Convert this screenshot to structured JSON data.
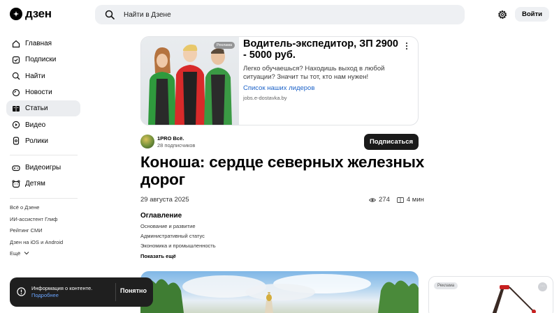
{
  "header": {
    "logo_text": "дзен",
    "search_placeholder": "Найти в Дзене",
    "login_label": "Войти"
  },
  "sidebar": {
    "main_items": [
      {
        "label": "Главная",
        "icon": "home-icon"
      },
      {
        "label": "Подписки",
        "icon": "subscriptions-icon"
      },
      {
        "label": "Найти",
        "icon": "search-icon"
      },
      {
        "label": "Новости",
        "icon": "news-icon"
      },
      {
        "label": "Статьи",
        "icon": "articles-icon",
        "active": true
      },
      {
        "label": "Видео",
        "icon": "video-icon"
      },
      {
        "label": "Ролики",
        "icon": "shorts-icon"
      }
    ],
    "extra_items": [
      {
        "label": "Видеоигры",
        "icon": "gamepad-icon"
      },
      {
        "label": "Детям",
        "icon": "kids-icon"
      }
    ],
    "footer_links": [
      "Всё о Дзене",
      "ИИ-ассистент Глиф",
      "Рейтинг СМИ",
      "Дзен на iOS и Android",
      "Ещё"
    ]
  },
  "ad": {
    "badge": "Реклама",
    "title": "Водитель-экспедитор, ЗП 2900 - 5000 руб.",
    "description": "Легко обучаешься? Находишь выход в любой ситуации? Значит ты тот, кто нам нужен!",
    "link": "Список наших лидеров",
    "domain": "jobs.e-dostavka.by"
  },
  "article": {
    "author_name": "1PRO Всё.",
    "author_subscribers": "28 подписчиков",
    "subscribe_label": "Подписаться",
    "title": "Коноша: сердце северных железных дорог",
    "date": "29 августа 2025",
    "views": "274",
    "read_time": "4 мин",
    "toc_title": "Оглавление",
    "toc_items": [
      "Основание и развитие",
      "Административный статус",
      "Экономика и промышленность"
    ],
    "toc_more": "Показать ещё"
  },
  "right_ad": {
    "badge": "Реклама",
    "more": "···"
  },
  "toast": {
    "text": "Информация о контенте.",
    "link": "Подробнее",
    "button": "Понятно"
  },
  "colors": {
    "accent_link": "#1d63c8",
    "button_dark": "#1a1a1a",
    "active_nav_bg": "#ebedf0"
  }
}
